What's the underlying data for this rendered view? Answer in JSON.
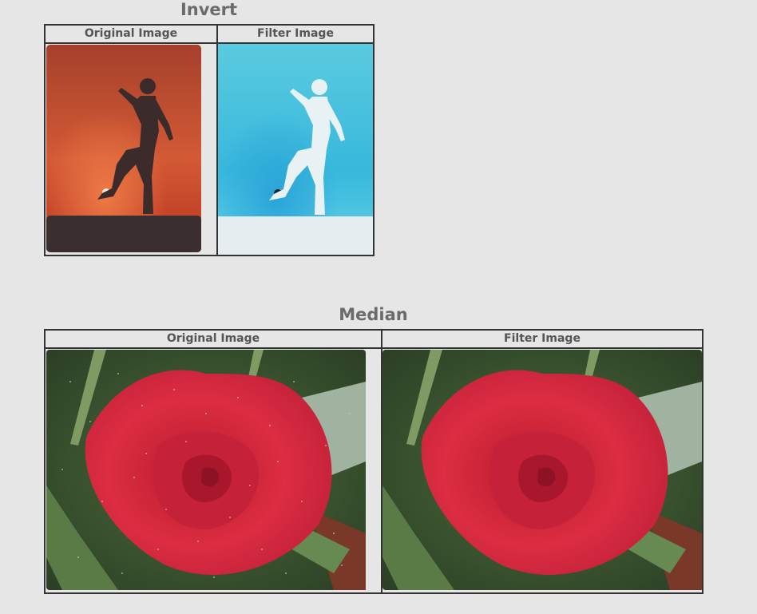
{
  "sections": [
    {
      "title": "Invert",
      "headers": [
        "Original Image",
        "Filter Image"
      ],
      "images": [
        "sunset-silhouette-original",
        "sunset-silhouette-inverted"
      ]
    },
    {
      "title": "Median",
      "headers": [
        "Original Image",
        "Filter Image"
      ],
      "images": [
        "rose-original-noisy",
        "rose-median-filtered"
      ]
    }
  ]
}
